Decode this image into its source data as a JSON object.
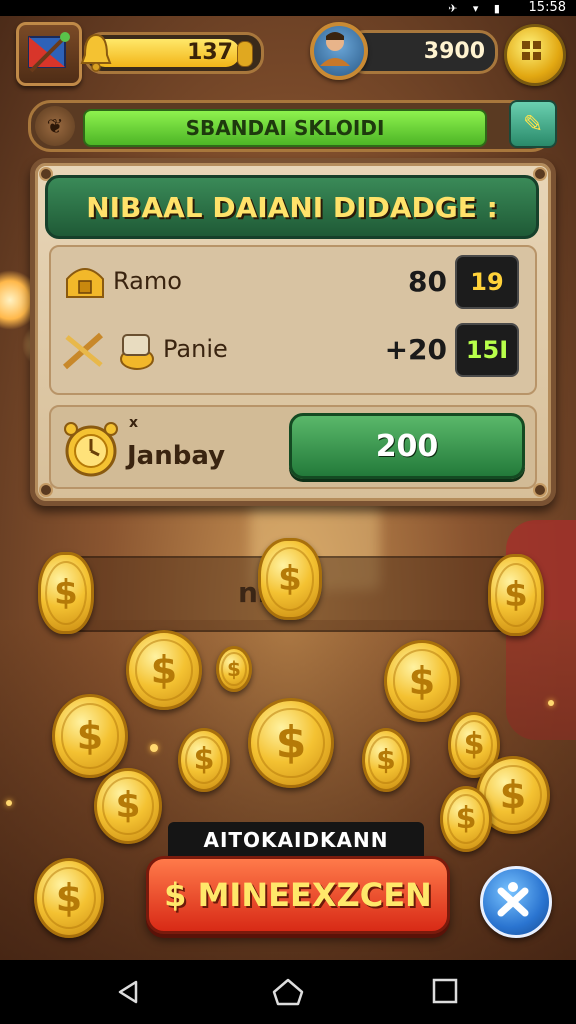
{
  "status_bar": {
    "time": "15:58",
    "icons": "✈ ▾ ▮"
  },
  "hud": {
    "gold_value": "137",
    "gold_fill_percent": 90,
    "coin_value": "3900"
  },
  "banner": {
    "text": "SBANDAI SKLOIDI",
    "cap_icon": "leaf-icon",
    "button_icon": "pencil-icon"
  },
  "panel": {
    "title": "NIBAAL DAIANI DIDADGE :",
    "rows": [
      {
        "label": "Ramo",
        "amount": "80",
        "badge": "19",
        "badge_color": "#ffd23a",
        "icon": "chest-icon"
      },
      {
        "label": "Panie",
        "amount": "+20",
        "badge": "15I",
        "badge_color": "#b8ff4a",
        "icon": "tools-icon"
      }
    ],
    "bonus": {
      "label": "Janbay",
      "mark": "x",
      "button": "200",
      "icon": "alarm-clock-icon"
    }
  },
  "background_strip": {
    "text": "nl"
  },
  "bottom": {
    "cta_label": "AITOKAIDKANN",
    "cta_button": "$ MINEEXZCEN",
    "close_icon": "close-x-icon"
  },
  "colors": {
    "accent_gold": "#f4c232",
    "panel_green": "#1f5a36",
    "cta_red": "#d82a16",
    "banner_green": "#4db526"
  },
  "coin_symbol": "$"
}
